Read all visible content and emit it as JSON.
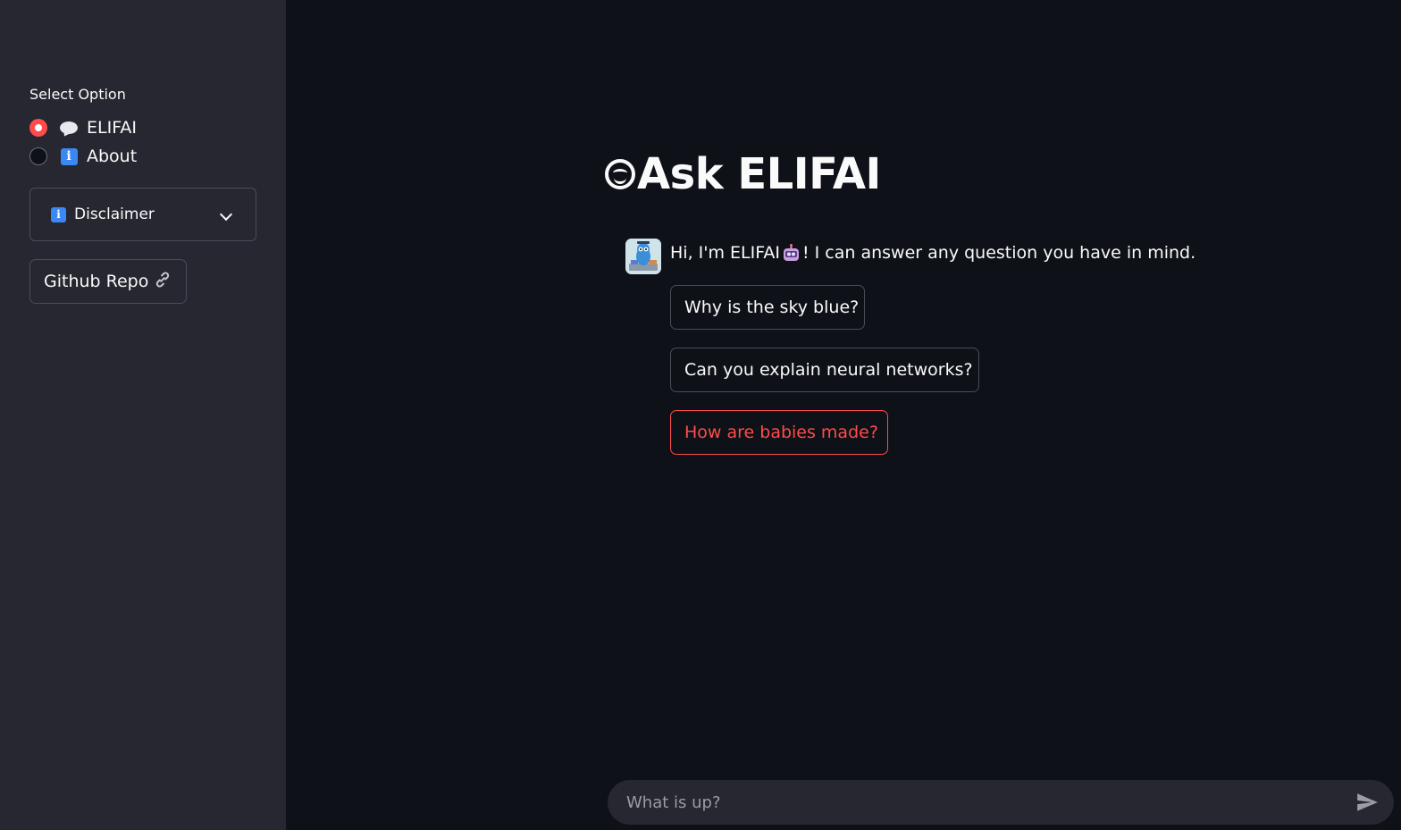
{
  "sidebar": {
    "radio_title": "Select Option",
    "options": [
      {
        "label": "ELIFAI",
        "icon": "speech-bubble-icon",
        "selected": true
      },
      {
        "label": "About",
        "icon": "info-icon",
        "selected": false
      }
    ],
    "expander": {
      "label": "Disclaimer",
      "icon": "info-icon",
      "state": "collapsed"
    },
    "github_button": {
      "label": "Github Repo",
      "icon": "link-icon"
    }
  },
  "main": {
    "title": "Ask ELIFAI",
    "title_icon": "smiling-face-icon",
    "greeting": {
      "before_emoji": "Hi, I'm ELIFAI",
      "emoji": "robot-icon",
      "after_emoji": "! I can answer any question you have in mind."
    },
    "suggestions": [
      "Why is the sky blue?",
      "Can you explain neural networks?",
      "How are babies made?"
    ]
  },
  "chat_input": {
    "placeholder": "What is up?"
  },
  "colors": {
    "background": "#0e1117",
    "sidebar": "#262730",
    "accent": "#ff4b4b",
    "text": "#fafafa"
  }
}
